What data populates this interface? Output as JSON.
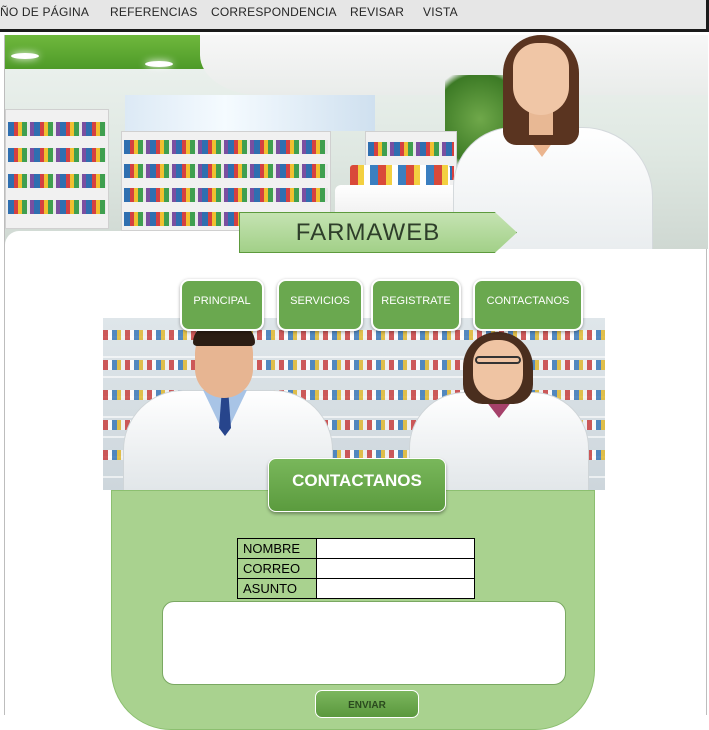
{
  "ribbon": {
    "tabs": [
      "ÑO DE PÁGINA",
      "REFERENCIAS",
      "CORRESPONDENCIA",
      "REVISAR",
      "VISTA"
    ]
  },
  "site": {
    "title": "FARMAWEB"
  },
  "nav": {
    "items": [
      {
        "label": "PRINCIPAL"
      },
      {
        "label": "SERVICIOS"
      },
      {
        "label": "REGISTRATE"
      },
      {
        "label": "CONTACTANOS"
      }
    ]
  },
  "contact": {
    "title": "CONTACTANOS",
    "fields": [
      {
        "label": "NOMBRE",
        "value": ""
      },
      {
        "label": "CORREO",
        "value": ""
      },
      {
        "label": "ASUNTO",
        "value": ""
      }
    ],
    "message": "",
    "submit_label": "ENVIAR"
  },
  "colors": {
    "accent_green": "#6aa84f",
    "panel_green": "#a9d28f",
    "title_green": "#a2d088"
  }
}
